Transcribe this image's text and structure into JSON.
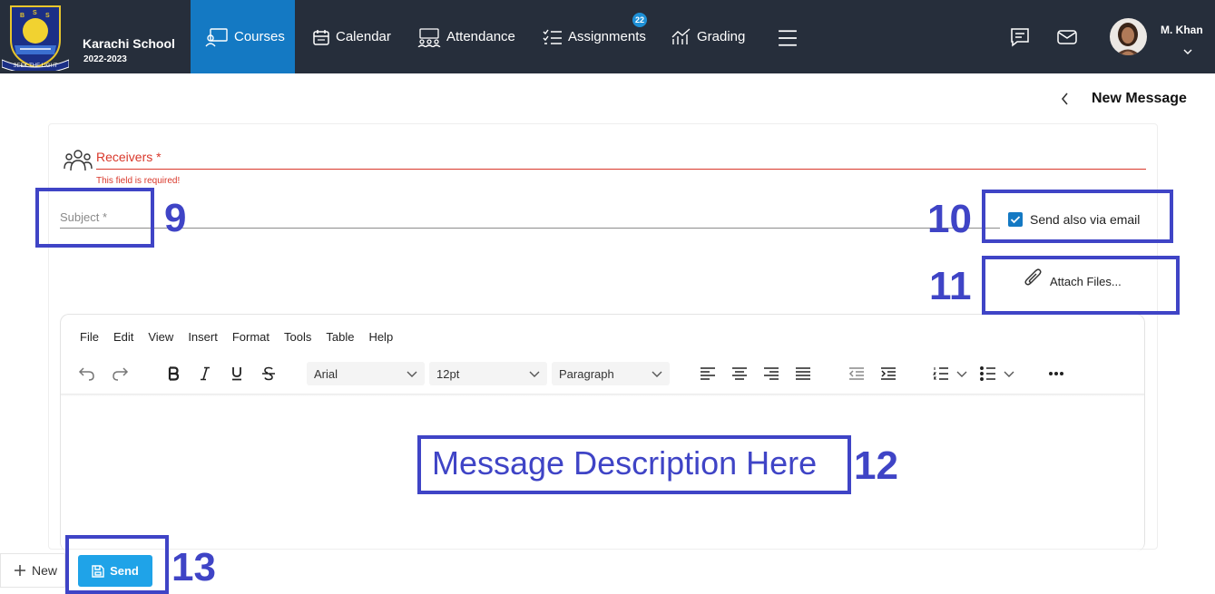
{
  "school": {
    "name": "Karachi School",
    "year": "2022-2023",
    "logo_letters": [
      "B",
      "S",
      "S"
    ],
    "logo_motto": "SEEK THE LIGHT"
  },
  "nav": {
    "courses": "Courses",
    "calendar": "Calendar",
    "attendance": "Attendance",
    "assignments": "Assignments",
    "assignments_badge": "22",
    "grading": "Grading"
  },
  "user": {
    "name": "M. Khan"
  },
  "page": {
    "title": "New Message"
  },
  "form": {
    "receivers_label": "Receivers *",
    "receivers_error": "This field is required!",
    "subject_placeholder": "Subject *",
    "email_option": "Send also via email",
    "email_checked": true,
    "attach_label": "Attach Files..."
  },
  "editor": {
    "menus": [
      "File",
      "Edit",
      "View",
      "Insert",
      "Format",
      "Tools",
      "Table",
      "Help"
    ],
    "font": "Arial",
    "size": "12pt",
    "block": "Paragraph"
  },
  "annotations": {
    "n9": "9",
    "n10": "10",
    "n11": "11",
    "n12": "12",
    "n13": "13",
    "description": "Message Description Here"
  },
  "actions": {
    "new": "New",
    "send": "Send"
  },
  "colors": {
    "nav_bg": "#262e3b",
    "nav_active": "#1479c3",
    "error": "#d9372a",
    "annotation": "#3f44c6",
    "send_btn": "#1fa3e8"
  }
}
